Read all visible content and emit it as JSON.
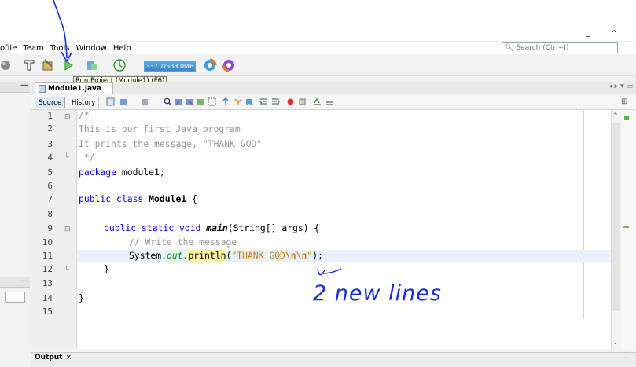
{
  "menu": [
    "ofile",
    "Team",
    "Tools",
    "Window",
    "Help"
  ],
  "search": {
    "placeholder": "Search (Ctrl+I)"
  },
  "toolbar": {
    "memory": "337.7/533.0MB"
  },
  "tooltip": "Run Project (Module1) (F6)",
  "editor": {
    "tab_label": "Module1.java",
    "source_label": "Source",
    "history_label": "History"
  },
  "code": {
    "lines": [
      {
        "n": "1",
        "text": "/*"
      },
      {
        "n": "2",
        "text": "This is our first Java program"
      },
      {
        "n": "3",
        "text": "It prints the message, \"THANK GOD\""
      },
      {
        "n": "4",
        "text": "*/"
      },
      {
        "n": "5",
        "text": "package module1;"
      },
      {
        "n": "6",
        "text": ""
      },
      {
        "n": "7",
        "text": "public class Module1 {"
      },
      {
        "n": "8",
        "text": ""
      },
      {
        "n": "9",
        "text": "public static void main(String[] args) {"
      },
      {
        "n": "10",
        "text": "// Write the message"
      },
      {
        "n": "11",
        "text": "System.out.println(\"THANK GOD\\n\\n\");"
      },
      {
        "n": "12",
        "text": "}"
      },
      {
        "n": "13",
        "text": ""
      },
      {
        "n": "14",
        "text": "}"
      },
      {
        "n": "15",
        "text": ""
      }
    ]
  },
  "output": {
    "label": "Output",
    "close": "×"
  },
  "annotation": {
    "text": "2 new lines"
  },
  "colors": {
    "keyword": "#0000e6",
    "string": "#ce7b00",
    "comment": "#969696",
    "annotation": "#1a2ed8"
  }
}
